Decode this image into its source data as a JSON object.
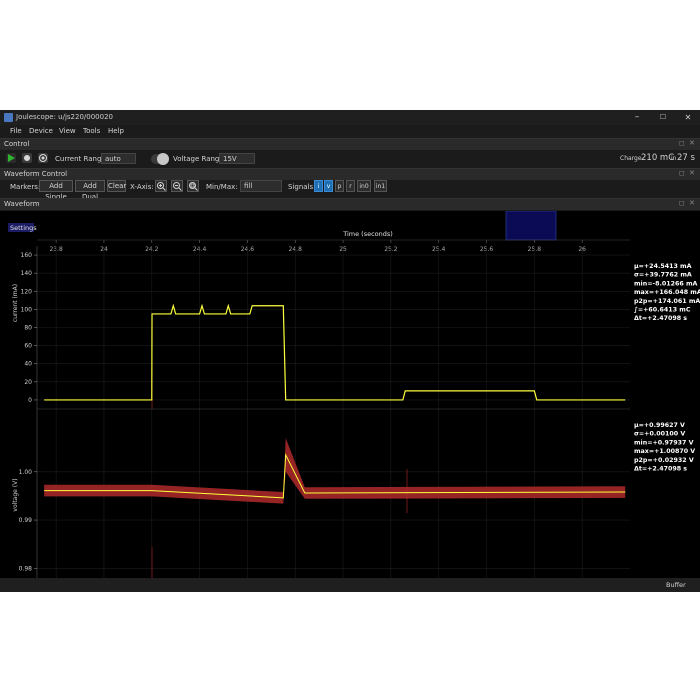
{
  "window": {
    "title": "Joulescope: u/js220/000020",
    "minimize": "–",
    "maximize": "☐",
    "close": "✕"
  },
  "menu": [
    "File",
    "Device",
    "View",
    "Tools",
    "Help"
  ],
  "control": {
    "title": "Control",
    "current_range_label": "Current Range",
    "current_range_value": "auto",
    "voltage_range_label": "Voltage Range",
    "voltage_range_value": "15V",
    "charge_label": "Charge",
    "charge_value": "210 mC",
    "charge_in": "in",
    "charge_time": "27 s"
  },
  "waveform_control": {
    "title": "Waveform Control",
    "markers_label": "Markers:",
    "add_single": "Add Single",
    "add_dual": "Add Dual",
    "clear": "Clear",
    "x_axis_label": "X-Axis:",
    "minmax_label": "Min/Max:",
    "minmax_value": "fill",
    "signals_label": "Signals:",
    "signals": [
      {
        "label": "i",
        "on": true
      },
      {
        "label": "v",
        "on": true
      },
      {
        "label": "p",
        "on": false
      },
      {
        "label": "r",
        "on": false
      },
      {
        "label": "in0",
        "on": false
      },
      {
        "label": "in1",
        "on": false
      }
    ]
  },
  "waveform": {
    "title": "Waveform",
    "settings": "Settings",
    "time_axis_label": "Time (seconds)",
    "time_ticks": [
      "23.8",
      "24",
      "24.2",
      "24.4",
      "24.6",
      "24.8",
      "25",
      "25.2",
      "25.4",
      "25.6",
      "25.8",
      "26"
    ],
    "current_axis_label": "current (mA)",
    "current_ticks": [
      "160",
      "140",
      "120",
      "100",
      "80",
      "60",
      "40",
      "20",
      "0"
    ],
    "voltage_axis_label": "voltage (V)",
    "voltage_ticks": [
      "1.00",
      "0.99",
      "0.98"
    ],
    "current_stats": [
      "µ=+24.5413 mA",
      "σ=+39.7762 mA",
      "min=-8.01266 mA",
      "max=+166.048 mA",
      "p2p=+174.061 mA",
      "∫=+60.6413 mC",
      "Δt=+2.47098  s"
    ],
    "voltage_stats": [
      "µ=+0.99627  V",
      "σ=+0.00100  V",
      "min=+0.97937  V",
      "max=+1.00870  V",
      "p2p=+0.02932  V",
      "Δt=+2.47098  s"
    ]
  },
  "status": {
    "buffer": "Buffer"
  },
  "colors": {
    "trace": "#ffff3c",
    "fill": "#b02a2a",
    "accent": "#1f6fb5",
    "overview": "#0b0b55"
  },
  "chart_data": [
    {
      "type": "line",
      "xlabel": "Time (seconds)",
      "ylabel": "current (mA)",
      "xlim": [
        23.72,
        26.2
      ],
      "ylim": [
        -10,
        170
      ],
      "grid": true,
      "series": [
        {
          "x": [
            23.75,
            24.2,
            24.201,
            24.28,
            24.29,
            24.3,
            24.31,
            24.4,
            24.41,
            24.42,
            24.43,
            24.51,
            24.52,
            24.53,
            24.54,
            24.61,
            24.62,
            24.75,
            24.76,
            25.25,
            25.26,
            25.8,
            25.81,
            26.18
          ],
          "y": [
            0,
            0,
            95,
            95,
            104,
            95,
            95,
            95,
            104,
            95,
            95,
            95,
            104,
            95,
            95,
            95,
            104,
            104,
            0,
            0,
            10,
            10,
            0,
            0
          ]
        }
      ]
    },
    {
      "type": "area",
      "xlabel": "Time (seconds)",
      "ylabel": "voltage (V)",
      "xlim": [
        23.72,
        26.2
      ],
      "ylim": [
        0.978,
        1.013
      ],
      "grid": true,
      "series": [
        {
          "x": [
            23.75,
            24.2,
            24.75,
            24.76,
            24.84,
            26.18
          ],
          "y": [
            0.9961,
            0.9961,
            0.9946,
            1.0035,
            0.9956,
            0.9958
          ]
        }
      ]
    }
  ]
}
